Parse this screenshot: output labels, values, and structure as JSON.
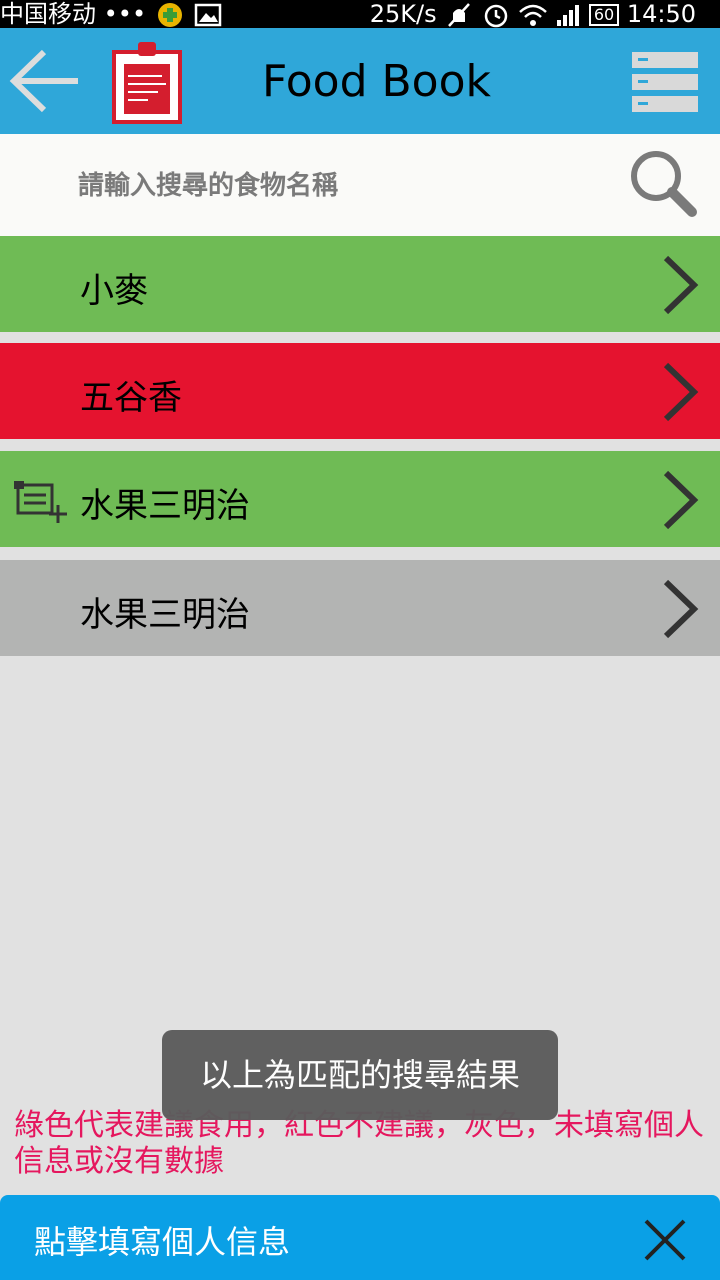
{
  "status_bar": {
    "carrier": "中国移动 •••",
    "network_speed": "25K/s",
    "battery": "60",
    "time": "14:50"
  },
  "app_bar": {
    "title": "Food Book",
    "icons": [
      "back-arrow-icon",
      "clipboard-icon",
      "menu-icon"
    ]
  },
  "search": {
    "placeholder": "請輸入搜尋的食物名稱",
    "value": ""
  },
  "results": [
    {
      "label": "小麥",
      "color": "#6fbb55",
      "status": "recommended"
    },
    {
      "label": "五谷香",
      "color": "#e5132f",
      "status": "not-recommended"
    },
    {
      "label": "水果三明治",
      "color": "#6fbb55",
      "status": "recommended"
    },
    {
      "label": "水果三明治",
      "color": "#b3b4b3",
      "status": "no-data"
    }
  ],
  "toast": {
    "message": "以上為匹配的搜尋結果"
  },
  "legend": {
    "text": "綠色代表建議食用，紅色不建議，灰色，未填寫個人信息或沒有數據"
  },
  "bottom_banner": {
    "label": "點擊填寫個人信息"
  },
  "colors": {
    "app_bar": "#2fa7d9",
    "green": "#6fbb55",
    "red": "#e5132f",
    "gray": "#b3b4b3",
    "legend_text": "#e5175e",
    "bottom_bar": "#0aa0e6"
  }
}
